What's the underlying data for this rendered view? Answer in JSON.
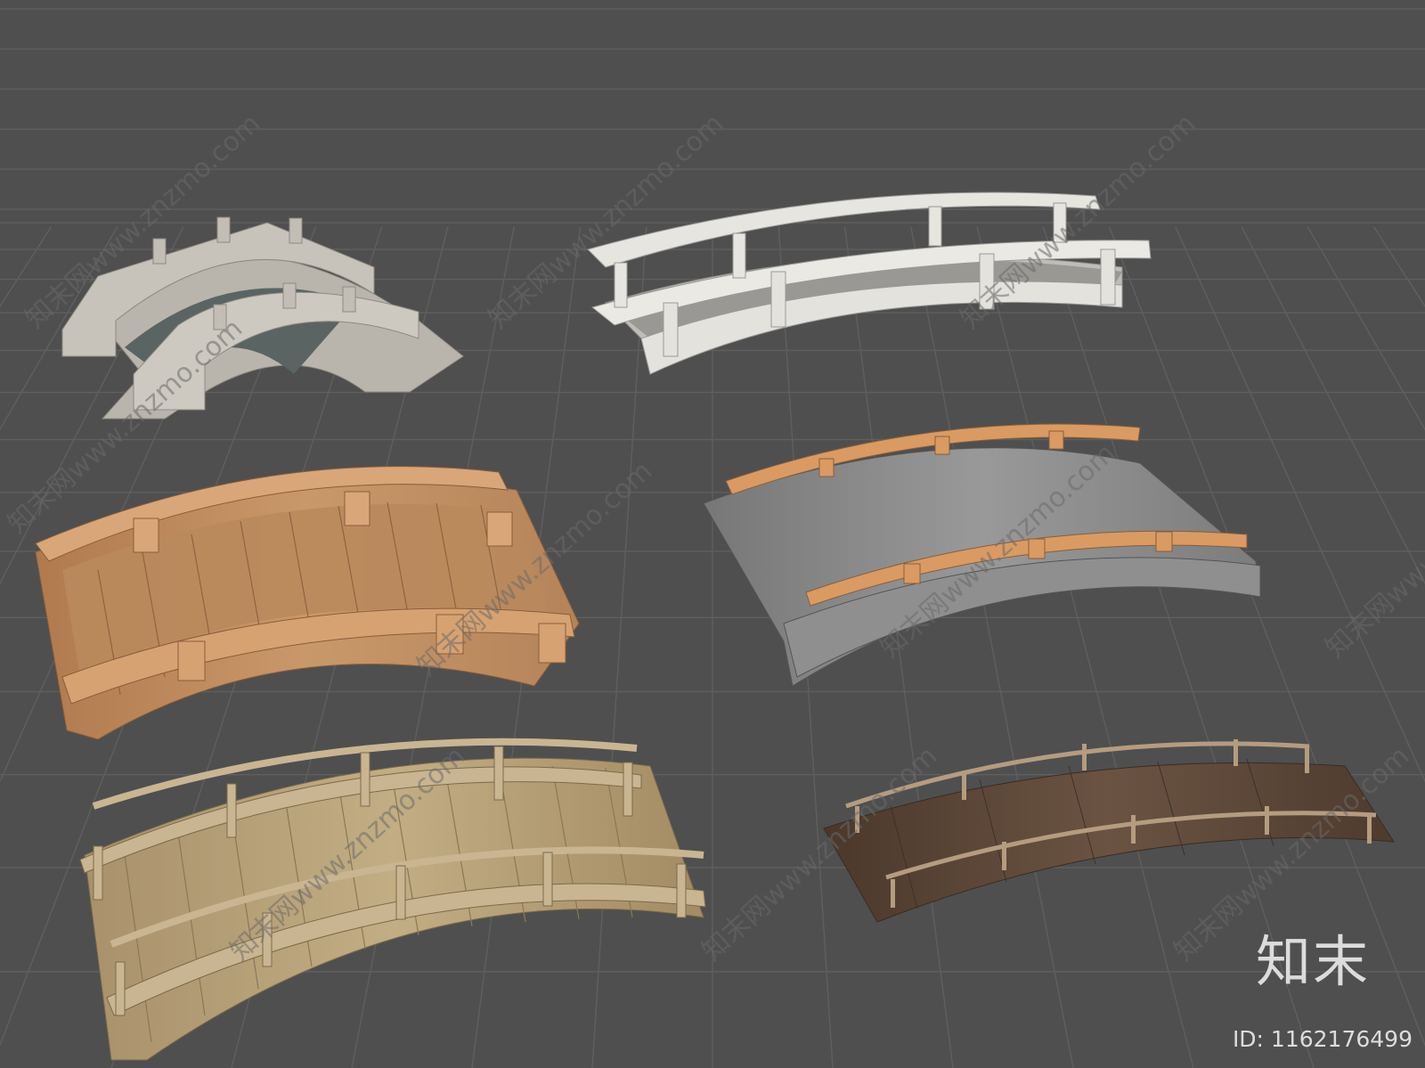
{
  "watermark": {
    "brand": "知末",
    "id_label": "ID: 1162176499",
    "tiled_text": "知末网www.znzmo.com"
  },
  "scene": {
    "background": "#4f4f4f",
    "grid_color": "#5e5e5e",
    "objects": [
      {
        "name": "stone-arch-bridge",
        "material": "stone",
        "color": "#b8b4ab"
      },
      {
        "name": "white-concrete-bridge",
        "material": "concrete",
        "color": "#e1dfda"
      },
      {
        "name": "orange-wood-bridge",
        "material": "wood",
        "color": "#c08a5c"
      },
      {
        "name": "stone-deck-wood-rail-bridge",
        "material": "stone-wood",
        "color": "#8a8a8a"
      },
      {
        "name": "light-plank-bridge",
        "material": "wood",
        "color": "#b9a27a"
      },
      {
        "name": "dark-wood-bridge",
        "material": "dark-wood",
        "color": "#5c4636"
      }
    ]
  }
}
